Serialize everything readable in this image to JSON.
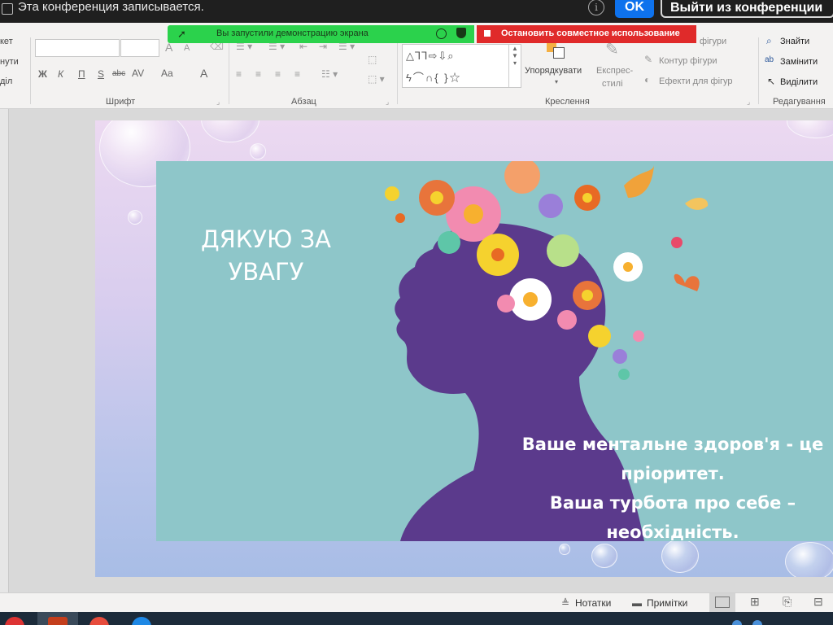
{
  "recording": {
    "text": "Эта конференция записывается.",
    "ok_label": "OK",
    "leave_label": "Выйти из конференции"
  },
  "share_banner": {
    "text": "Вы запустили демонстрацию экрана",
    "stop_label": "Остановить совместное использование"
  },
  "ribbon": {
    "left_items": [
      "кет",
      "нути",
      "діл"
    ],
    "font_group": "Шрифт",
    "paragraph_group": "Абзац",
    "drawing_group": "Креслення",
    "editing_group": "Редагування",
    "arrange_label": "Упорядкувати",
    "quick_styles_label": [
      "Експрес-",
      "стилі"
    ],
    "shape_fill_label": "фігури",
    "shape_outline_label": "Контур фігури",
    "shape_effects_label": "Ефекти для фігур",
    "find_label": "Знайти",
    "replace_label": "Замінити",
    "select_label": "Виділити",
    "font_buttons": [
      "Ж",
      "К",
      "П",
      "S",
      "abc",
      "AV",
      "Aa",
      "A"
    ]
  },
  "slide": {
    "thanks_line1": "ДЯКУЮ ЗА",
    "thanks_line2": "УВАГУ",
    "quote_line1": "Ваше ментальне здоров'я - це",
    "quote_line2": "пріоритет.",
    "quote_line3": "Ваша турбота про себе –",
    "quote_line4": "необхідність."
  },
  "statusbar": {
    "notes_label": "Нотатки",
    "comments_label": "Примітки"
  },
  "colors": {
    "accent_blue": "#0e72ed",
    "share_green": "#2bd24c",
    "stop_red": "#e02a2a",
    "slide_teal": "#8ec6c9",
    "silhouette_purple": "#5b3a8c"
  }
}
